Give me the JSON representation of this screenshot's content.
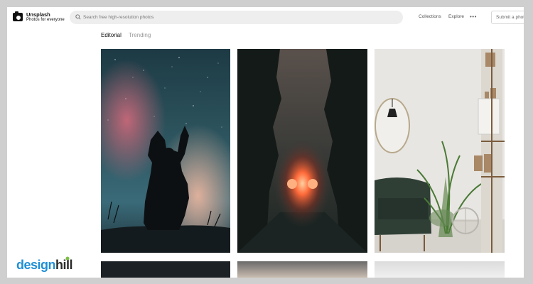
{
  "header": {
    "brand_name": "Unsplash",
    "brand_tagline": "Photos for everyone",
    "search_placeholder": "Search free high-resolution photos",
    "nav": {
      "collections": "Collections",
      "explore": "Explore",
      "more": "•••",
      "submit": "Submit a photo"
    }
  },
  "tabs": {
    "editorial": "Editorial",
    "trending": "Trending"
  },
  "photos": [
    {
      "subject": "woman-silhouette-starry-sky"
    },
    {
      "subject": "car-headlights-foggy-forest"
    },
    {
      "subject": "living-room-armchair-plants"
    }
  ],
  "watermark": {
    "text": "designhill",
    "colors": {
      "design": "#1f8fd6",
      "hill": "#2a2a2a",
      "dot": "#7bc043"
    }
  }
}
